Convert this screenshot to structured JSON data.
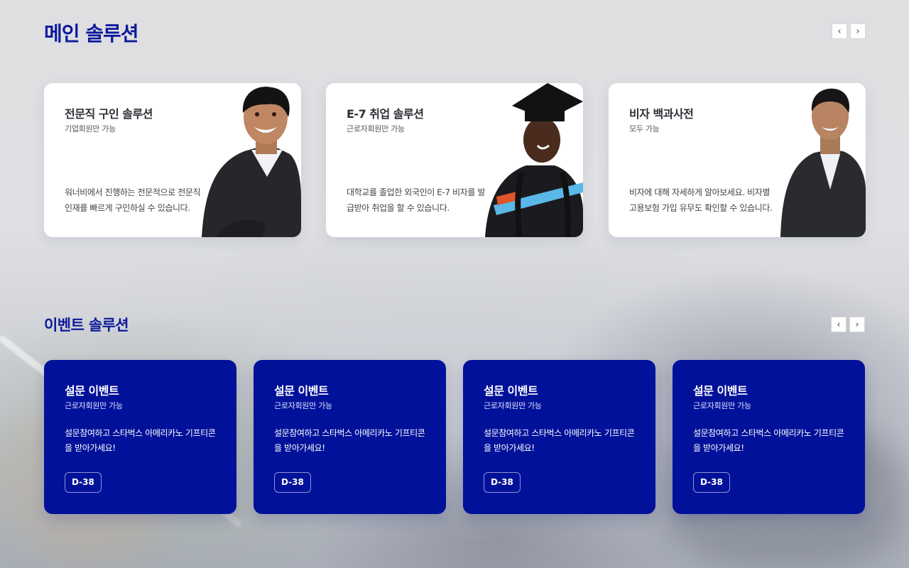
{
  "main_section": {
    "title": "메인 솔루션",
    "prev_icon": "chevron-left-icon",
    "next_icon": "chevron-right-icon",
    "cards": [
      {
        "title": "전문직 구인 솔루션",
        "subtitle": "기업회원만 가능",
        "description": "워너비에서 진행하는 전문적으로 전문직 인재를 빠르게 구인하실 수 있습니다."
      },
      {
        "title": "E-7 취업 솔루션",
        "subtitle": "근로자회원만 가능",
        "description": "대학교를 졸업한 외국인이 E-7 비자를 발급받아 취업을 할 수 있습니다."
      },
      {
        "title": "비자 백과사전",
        "subtitle": "모두 가능",
        "description": "비자에 대해 자세하게 알아보세요. 비자별 고용보험 가입 유무도 확인할 수 있습니다."
      }
    ]
  },
  "event_section": {
    "title": "이벤트 솔루션",
    "prev_icon": "chevron-left-icon",
    "next_icon": "chevron-right-icon",
    "cards": [
      {
        "title": "설문 이벤트",
        "subtitle": "근로자회원만 가능",
        "description": "설문참여하고 스타벅스 아메리카노 기프티콘을 받아가세요!",
        "badge": "D-38"
      },
      {
        "title": "설문 이벤트",
        "subtitle": "근로자회원만 가능",
        "description": "설문참여하고 스타벅스 아메리카노 기프티콘을 받아가세요!",
        "badge": "D-38"
      },
      {
        "title": "설문 이벤트",
        "subtitle": "근로자회원만 가능",
        "description": "설문참여하고 스타벅스 아메리카노 기프티콘을 받아가세요!",
        "badge": "D-38"
      },
      {
        "title": "설문 이벤트",
        "subtitle": "근로자회원만 가능",
        "description": "설문참여하고 스타벅스 아메리카노 기프티콘을 받아가세요!",
        "badge": "D-38"
      }
    ]
  },
  "colors": {
    "accent_title": "#0c1a9c",
    "event_card_bg": "#02119a",
    "page_bg": "#e1e2e6"
  }
}
